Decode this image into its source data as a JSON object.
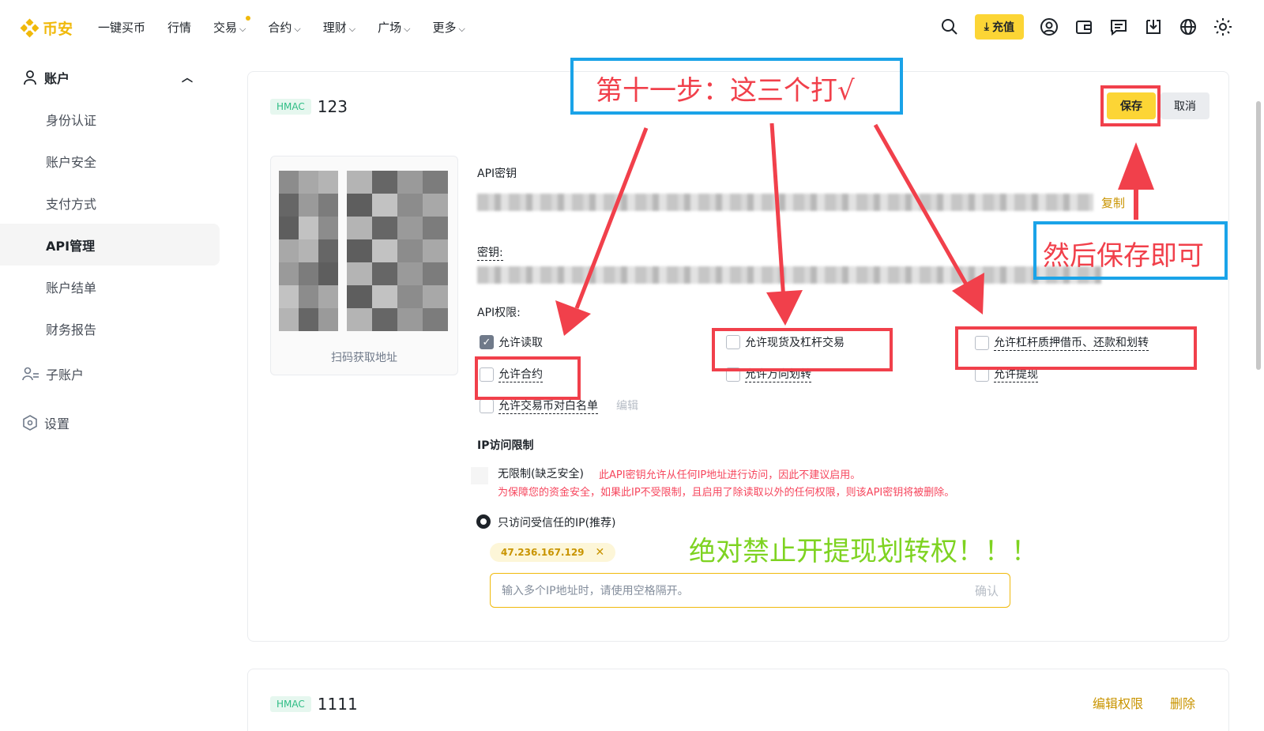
{
  "nav": {
    "logo_text": "币安",
    "items": [
      {
        "label": "一键买币",
        "chevron": false
      },
      {
        "label": "行情",
        "chevron": false
      },
      {
        "label": "交易",
        "chevron": true,
        "dot": true
      },
      {
        "label": "合约",
        "chevron": true
      },
      {
        "label": "理财",
        "chevron": true
      },
      {
        "label": "广场",
        "chevron": true
      },
      {
        "label": "更多",
        "chevron": true
      }
    ],
    "deposit_label": "充值",
    "icons": [
      "search-icon",
      "deposit-icon",
      "user-icon",
      "wallet-icon",
      "message-icon",
      "download-icon",
      "globe-icon",
      "theme-icon"
    ]
  },
  "sidebar": {
    "account_label": "账户",
    "items": [
      {
        "label": "身份认证"
      },
      {
        "label": "账户安全"
      },
      {
        "label": "支付方式"
      },
      {
        "label": "API管理",
        "active": true
      },
      {
        "label": "账户结单"
      },
      {
        "label": "财务报告"
      }
    ],
    "sub_account_label": "子账户",
    "settings_label": "设置"
  },
  "card1": {
    "badge": "HMAC",
    "name": "123",
    "save_label": "保存",
    "cancel_label": "取消",
    "qr_caption": "扫码获取地址",
    "api_key_label": "API密钥",
    "copy_label": "复制",
    "secret_label": "密钥:",
    "permissions_label": "API权限:",
    "permissions": {
      "read": "允许读取",
      "futures": "允许合约",
      "whitelist": "允许交易币对白名单",
      "spot": "允许现货及杠杆交易",
      "universal": "允许万向划转",
      "margin": "允许杠杆质押借币、还款和划转",
      "withdraw": "允许提现"
    },
    "edit_label": "编辑",
    "ip_label": "IP访问限制",
    "unrestricted_label": "无限制(缺乏安全)",
    "warn1": "此API密钥允许从任何IP地址进行访问，因此不建议启用。",
    "warn2": "为保障您的资金安全，如果此IP不受限制，且启用了除读取以外的任何权限，则该API密钥将被删除。",
    "trusted_label": "只访问受信任的IP(推荐)",
    "ip_tag": "47.236.167.129",
    "ip_placeholder": "输入多个IP地址时，请使用空格隔开。",
    "confirm_label": "确认"
  },
  "card2": {
    "badge": "HMAC",
    "name": "1111",
    "edit_perm_label": "编辑权限",
    "delete_label": "删除"
  },
  "annotations": {
    "step11": "第十一步：这三个打√",
    "then_save": "然后保存即可",
    "warning": "绝对禁止开提现划转权！！！"
  },
  "colors": {
    "brand": "#f0b90b",
    "annotation_red": "#f1404b",
    "annotation_blue": "#1aa3e8",
    "annotation_green": "#7ed321"
  }
}
